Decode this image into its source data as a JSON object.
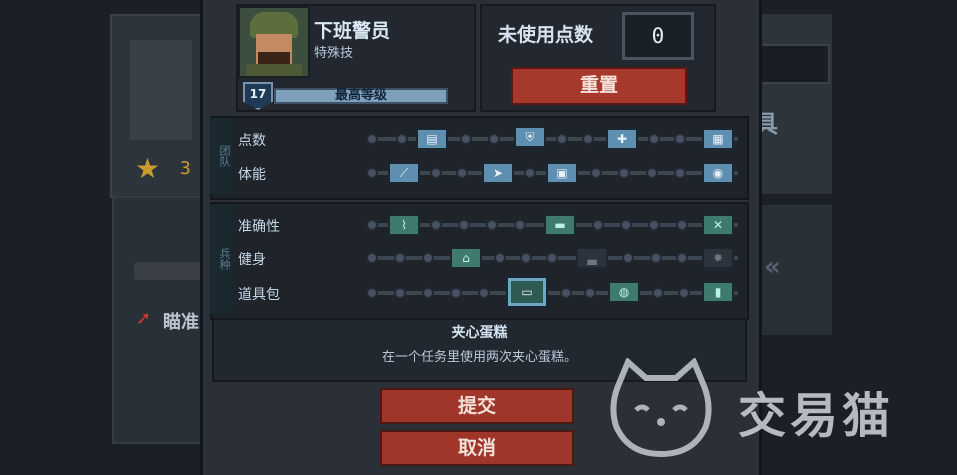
{
  "background": {
    "star_count": "3",
    "aim_label": "瞄准",
    "right_title_fragment": "具"
  },
  "hero": {
    "name": "下班警员",
    "class": "特殊技",
    "level": "17",
    "level_label": "最高等级"
  },
  "points": {
    "label": "未使用点数",
    "value": "0",
    "reset_label": "重置"
  },
  "panels": [
    {
      "tab": "团队",
      "rows": [
        {
          "label": "点数"
        },
        {
          "label": "体能"
        }
      ]
    },
    {
      "tab": "兵种",
      "rows": [
        {
          "label": "准确性"
        },
        {
          "label": "健身"
        },
        {
          "label": "道具包"
        }
      ]
    }
  ],
  "description": {
    "title": "夹心蛋糕",
    "text": "在一个任务里使用两次夹心蛋糕。"
  },
  "buttons": {
    "submit": "提交",
    "cancel": "取消"
  },
  "watermark": {
    "text": "交易猫"
  },
  "colors": {
    "accent_red": "#a7382c",
    "node_blue": "#5f8fb0",
    "node_teal": "#3e7a6e"
  }
}
